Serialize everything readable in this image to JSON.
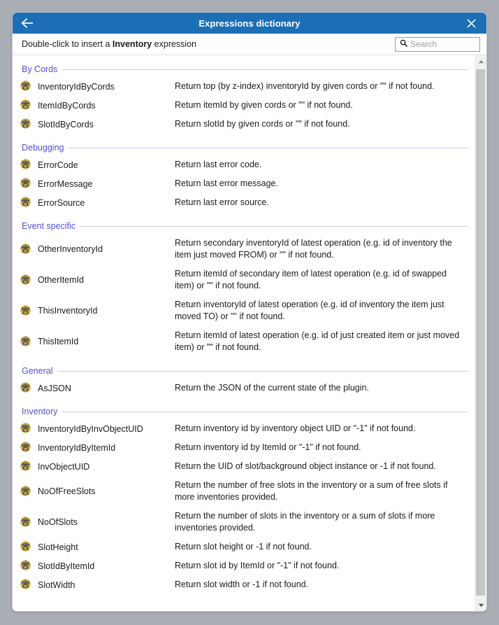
{
  "window": {
    "title": "Expressions dictionary",
    "back_icon": "arrow-left-icon",
    "close_icon": "close-icon"
  },
  "subheader": {
    "hint_prefix": "Double-click to insert a ",
    "hint_bold": "Inventory",
    "hint_suffix": " expression",
    "search": {
      "placeholder": "Search",
      "value": "",
      "icon": "search-icon"
    }
  },
  "scrollbar": {
    "up_icon": "chevron-up-icon",
    "down_icon": "chevron-down-icon"
  },
  "colors": {
    "titlebar": "#1c6fb5",
    "group_title": "#5151d6",
    "group_rule": "#c9c9ee",
    "page_background": "#a9adb4",
    "icon_gold": "#f2c31b",
    "icon_body": "#4c4c4c"
  },
  "groups": [
    {
      "title": "By Cords",
      "items": [
        {
          "icon": "plugin-expression-icon",
          "name": "InventoryIdByCords",
          "description": "Return top (by z-index) inventoryId by given cords or \"\" if not found."
        },
        {
          "icon": "plugin-expression-icon",
          "name": "ItemIdByCords",
          "description": "Return itemId by given cords or \"\" if not found."
        },
        {
          "icon": "plugin-expression-icon",
          "name": "SlotIdByCords",
          "description": "Return slotId by given cords or \"\" if not found."
        }
      ]
    },
    {
      "title": "Debugging",
      "items": [
        {
          "icon": "plugin-expression-icon",
          "name": "ErrorCode",
          "description": "Return last error code."
        },
        {
          "icon": "plugin-expression-icon",
          "name": "ErrorMessage",
          "description": "Return last error message."
        },
        {
          "icon": "plugin-expression-icon",
          "name": "ErrorSource",
          "description": "Return last error source."
        }
      ]
    },
    {
      "title": "Event specific",
      "items": [
        {
          "icon": "plugin-expression-icon",
          "name": "OtherInventoryId",
          "description": "Return secondary inventoryId of latest operation (e.g. id of inventory the item just moved FROM) or \"\" if not found.",
          "tall": true
        },
        {
          "icon": "plugin-expression-icon",
          "name": "OtherItemId",
          "description": "Return itemId of secondary item of latest operation (e.g. id of swapped item) or \"\" if not found.",
          "tall": true
        },
        {
          "icon": "plugin-expression-icon",
          "name": "ThisInventoryId",
          "description": "Return inventoryId of latest operation (e.g. id of inventory the item just moved TO) or \"\" if not found.",
          "tall": true
        },
        {
          "icon": "plugin-expression-icon",
          "name": "ThisItemId",
          "description": "Return itemId of latest operation (e.g. id of just created item or just moved item) or \"\" if not found.",
          "tall": true
        }
      ]
    },
    {
      "title": "General",
      "items": [
        {
          "icon": "plugin-expression-icon",
          "name": "AsJSON",
          "description": "Return the JSON of the current state of the plugin."
        }
      ]
    },
    {
      "title": "Inventory",
      "items": [
        {
          "icon": "plugin-expression-icon",
          "name": "InventoryIdByInvObjectUID",
          "description": "Return inventory id by inventory object UID or \"-1\" if not found."
        },
        {
          "icon": "plugin-expression-icon",
          "name": "InventoryIdByItemId",
          "description": "Return inventory id by ItemId or \"-1\" if not found."
        },
        {
          "icon": "plugin-expression-icon",
          "name": "InvObjectUID",
          "description": "Return the UID of slot/background object instance or -1 if not found."
        },
        {
          "icon": "plugin-expression-icon",
          "name": "NoOfFreeSlots",
          "description": "Return the number of free slots in the inventory or a sum of free slots if more inventories provided.",
          "tall": true
        },
        {
          "icon": "plugin-expression-icon",
          "name": "NoOfSlots",
          "description": "Return the number of slots in the inventory or a sum of slots if more inventories provided.",
          "tall": true
        },
        {
          "icon": "plugin-expression-icon",
          "name": "SlotHeight",
          "description": "Return slot height or -1 if not found."
        },
        {
          "icon": "plugin-expression-icon",
          "name": "SlotIdByItemId",
          "description": "Return slot id by ItemId or \"-1\" if not found."
        },
        {
          "icon": "plugin-expression-icon",
          "name": "SlotWidth",
          "description": "Return slot width or -1 if not found."
        }
      ]
    }
  ]
}
